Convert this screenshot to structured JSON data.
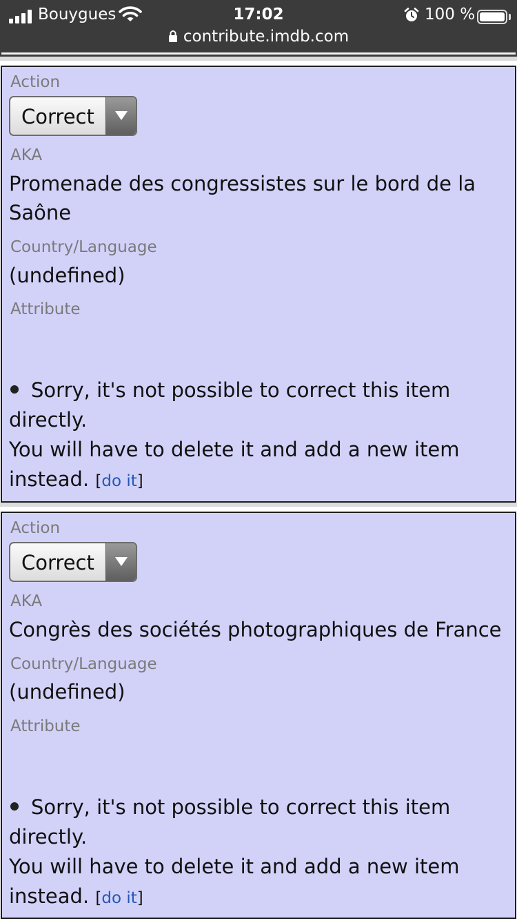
{
  "status_bar": {
    "carrier": "Bouygues",
    "time": "17:02",
    "battery": "100 %"
  },
  "url_bar": {
    "domain": "contribute.imdb.com"
  },
  "items": [
    {
      "action_label": "Action",
      "action_value": "Correct",
      "aka_label": "AKA",
      "aka_value": "Promenade des congressistes sur le bord de la Saône",
      "country_label": "Country/Language",
      "country_value": "(undefined)",
      "attribute_label": "Attribute",
      "message_line1": "Sorry, it's not possible to correct this item directly.",
      "message_line2": "You will have to delete it and add a new item instead.",
      "bracket_open": "[",
      "link_label": "do it",
      "bracket_close": "]"
    },
    {
      "action_label": "Action",
      "action_value": "Correct",
      "aka_label": "AKA",
      "aka_value": "Congrès des sociétés photographiques de France",
      "country_label": "Country/Language",
      "country_value": "(undefined)",
      "attribute_label": "Attribute",
      "message_line1": "Sorry, it's not possible to correct this item directly.",
      "message_line2": "You will have to delete it and add a new item instead.",
      "bracket_open": "[",
      "link_label": "do it",
      "bracket_close": "]"
    }
  ]
}
